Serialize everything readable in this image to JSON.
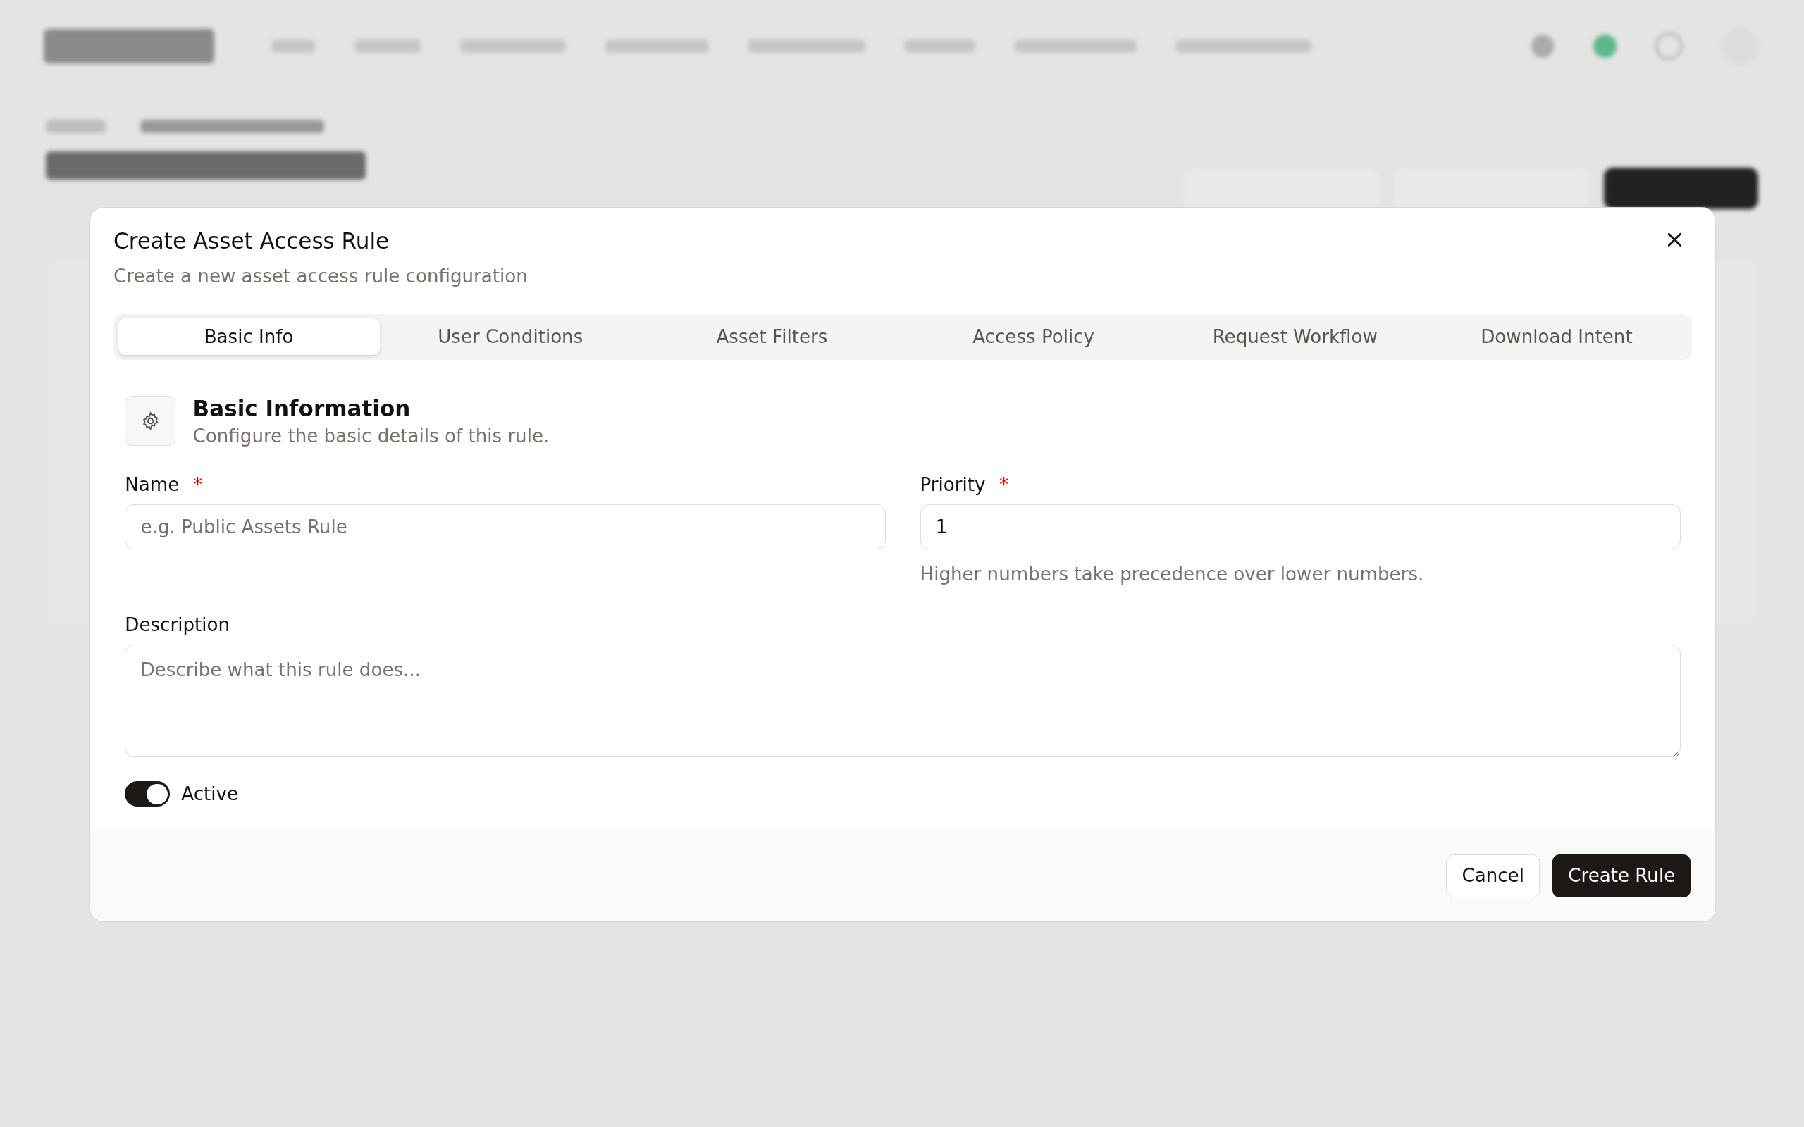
{
  "dialog": {
    "title": "Create Asset Access Rule",
    "subtitle": "Create a new asset access rule configuration",
    "tabs": [
      {
        "label": "Basic Info",
        "selected": true
      },
      {
        "label": "User Conditions",
        "selected": false
      },
      {
        "label": "Asset Filters",
        "selected": false
      },
      {
        "label": "Access Policy",
        "selected": false
      },
      {
        "label": "Request Workflow",
        "selected": false
      },
      {
        "label": "Download Intent",
        "selected": false
      }
    ],
    "section": {
      "title": "Basic Information",
      "subtitle": "Configure the basic details of this rule."
    },
    "name": {
      "label": "Name",
      "required_mark": "*",
      "placeholder": "e.g. Public Assets Rule"
    },
    "priority": {
      "label": "Priority",
      "required_mark": "*",
      "value": "1",
      "hint": "Higher numbers take precedence over lower numbers."
    },
    "description": {
      "label": "Description",
      "placeholder": "Describe what this rule does..."
    },
    "active": {
      "label": "Active",
      "on": true
    },
    "buttons": [
      {
        "label": "Cancel",
        "kind": "secondary"
      },
      {
        "label": "Create Rule",
        "kind": "primary"
      }
    ]
  }
}
